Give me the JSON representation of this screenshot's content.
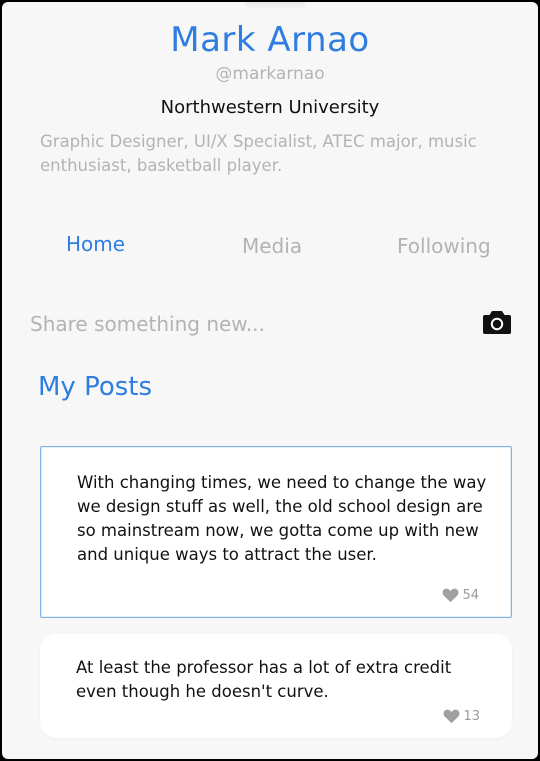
{
  "profile": {
    "name": "Mark Arnao",
    "handle": "@markarnao",
    "school": "Northwestern University",
    "bio": "Graphic Designer, UI/X Specialist, ATEC major, music enthusiast, basketball player."
  },
  "tabs": [
    {
      "label": "Home",
      "active": true
    },
    {
      "label": "Media",
      "active": false
    },
    {
      "label": "Following",
      "active": false
    }
  ],
  "composer": {
    "placeholder": "Share something new...",
    "icon": "camera-icon"
  },
  "section": {
    "title": "My Posts"
  },
  "posts": [
    {
      "text": "With changing times, we need to change the way we design stuff as well, the old school design are so mainstream now, we gotta come up with new and unique ways to attract the user.",
      "likes": "54"
    },
    {
      "text": "At least the professor has a lot of extra credit even though he doesn't curve.",
      "likes": "13"
    }
  ],
  "colors": {
    "accent": "#2f7de1",
    "muted": "#b3b3b3",
    "background": "#f7f7f7"
  }
}
